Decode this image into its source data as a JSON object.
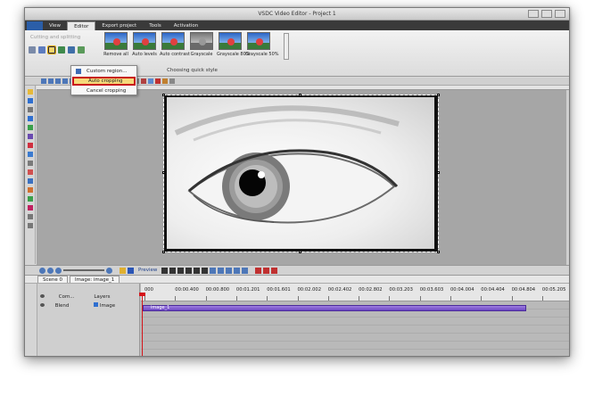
{
  "window": {
    "title": "VSDC Video Editor - Project 1"
  },
  "tabs": [
    {
      "label": ""
    },
    {
      "label": "View"
    },
    {
      "label": "Editor"
    },
    {
      "label": "Export project"
    },
    {
      "label": "Tools"
    },
    {
      "label": "Activation"
    }
  ],
  "ribbon": {
    "cutting_label": "Cutting and splitting",
    "group_label": "Choosing quick style",
    "effects": [
      {
        "label": "Remove all",
        "style": "color"
      },
      {
        "label": "Auto levels",
        "style": "color"
      },
      {
        "label": "Auto contrast",
        "style": "color"
      },
      {
        "label": "Grayscale",
        "style": "gray"
      },
      {
        "label": "Grayscale 80%",
        "style": "color"
      },
      {
        "label": "Grayscale 50%",
        "style": "color"
      }
    ]
  },
  "dropdown": {
    "items": [
      {
        "label": "Custom region..."
      },
      {
        "label": "Auto cropping"
      },
      {
        "label": "Cancel cropping"
      }
    ]
  },
  "timeline_toolbar": {
    "preview_label": "Preview"
  },
  "timeline_tabs": [
    {
      "label": "Scene 0"
    },
    {
      "label": "Image: image_1"
    }
  ],
  "timeline": {
    "header": {
      "com_label": "Com...",
      "layers_label": "Layers",
      "blend_label": "Blend",
      "track_label": "Image"
    },
    "ticks": [
      "000",
      "00:00.400",
      "00:00.800",
      "00:01.201",
      "00:01.601",
      "00:02.002",
      "00:02.402",
      "00:02.802",
      "00:03.203",
      "00:03.603",
      "00:04.004",
      "00:04.404",
      "00:04.804",
      "00:05.205"
    ],
    "clip_label": "image_1"
  }
}
